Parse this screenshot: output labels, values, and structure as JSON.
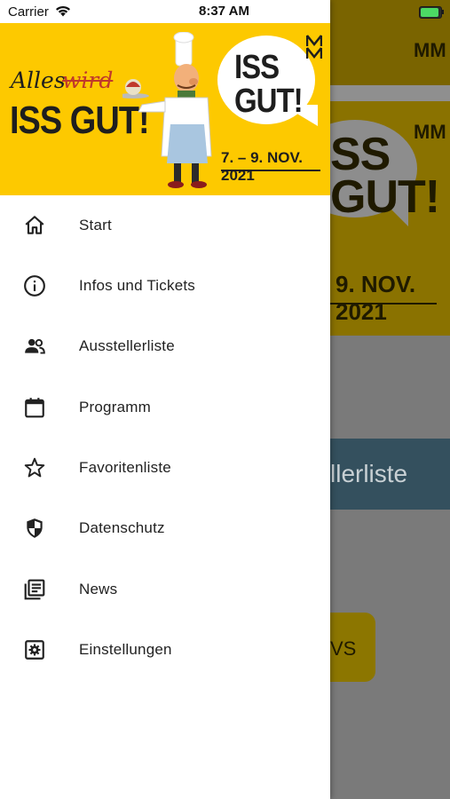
{
  "status_bar": {
    "carrier": "Carrier",
    "time": "8:37 AM"
  },
  "header": {
    "slogan_word1": "Alles",
    "slogan_word2": "wird",
    "slogan_main": "ISS GUT!",
    "bubble_line1": "ISS",
    "bubble_line2": "GUT!",
    "dates": "7. – 9. NOV. 2021",
    "logo_text": "MM"
  },
  "menu": {
    "items": [
      {
        "label": "Start",
        "icon": "home-icon"
      },
      {
        "label": "Infos und Tickets",
        "icon": "info-icon"
      },
      {
        "label": "Ausstellerliste",
        "icon": "people-icon"
      },
      {
        "label": "Programm",
        "icon": "calendar-icon"
      },
      {
        "label": "Favoritenliste",
        "icon": "star-icon"
      },
      {
        "label": "Datenschutz",
        "icon": "shield-icon"
      },
      {
        "label": "News",
        "icon": "news-icon"
      },
      {
        "label": "Einstellungen",
        "icon": "settings-icon"
      }
    ]
  },
  "background": {
    "banner_text1": "SS",
    "banner_text2": "GUT!",
    "banner_date": "9. NOV. 2021",
    "card_label": "llerliste",
    "button_label": "VS",
    "logo_text": "MM"
  },
  "colors": {
    "brand_yellow": "#fdc900",
    "text": "#222222"
  }
}
